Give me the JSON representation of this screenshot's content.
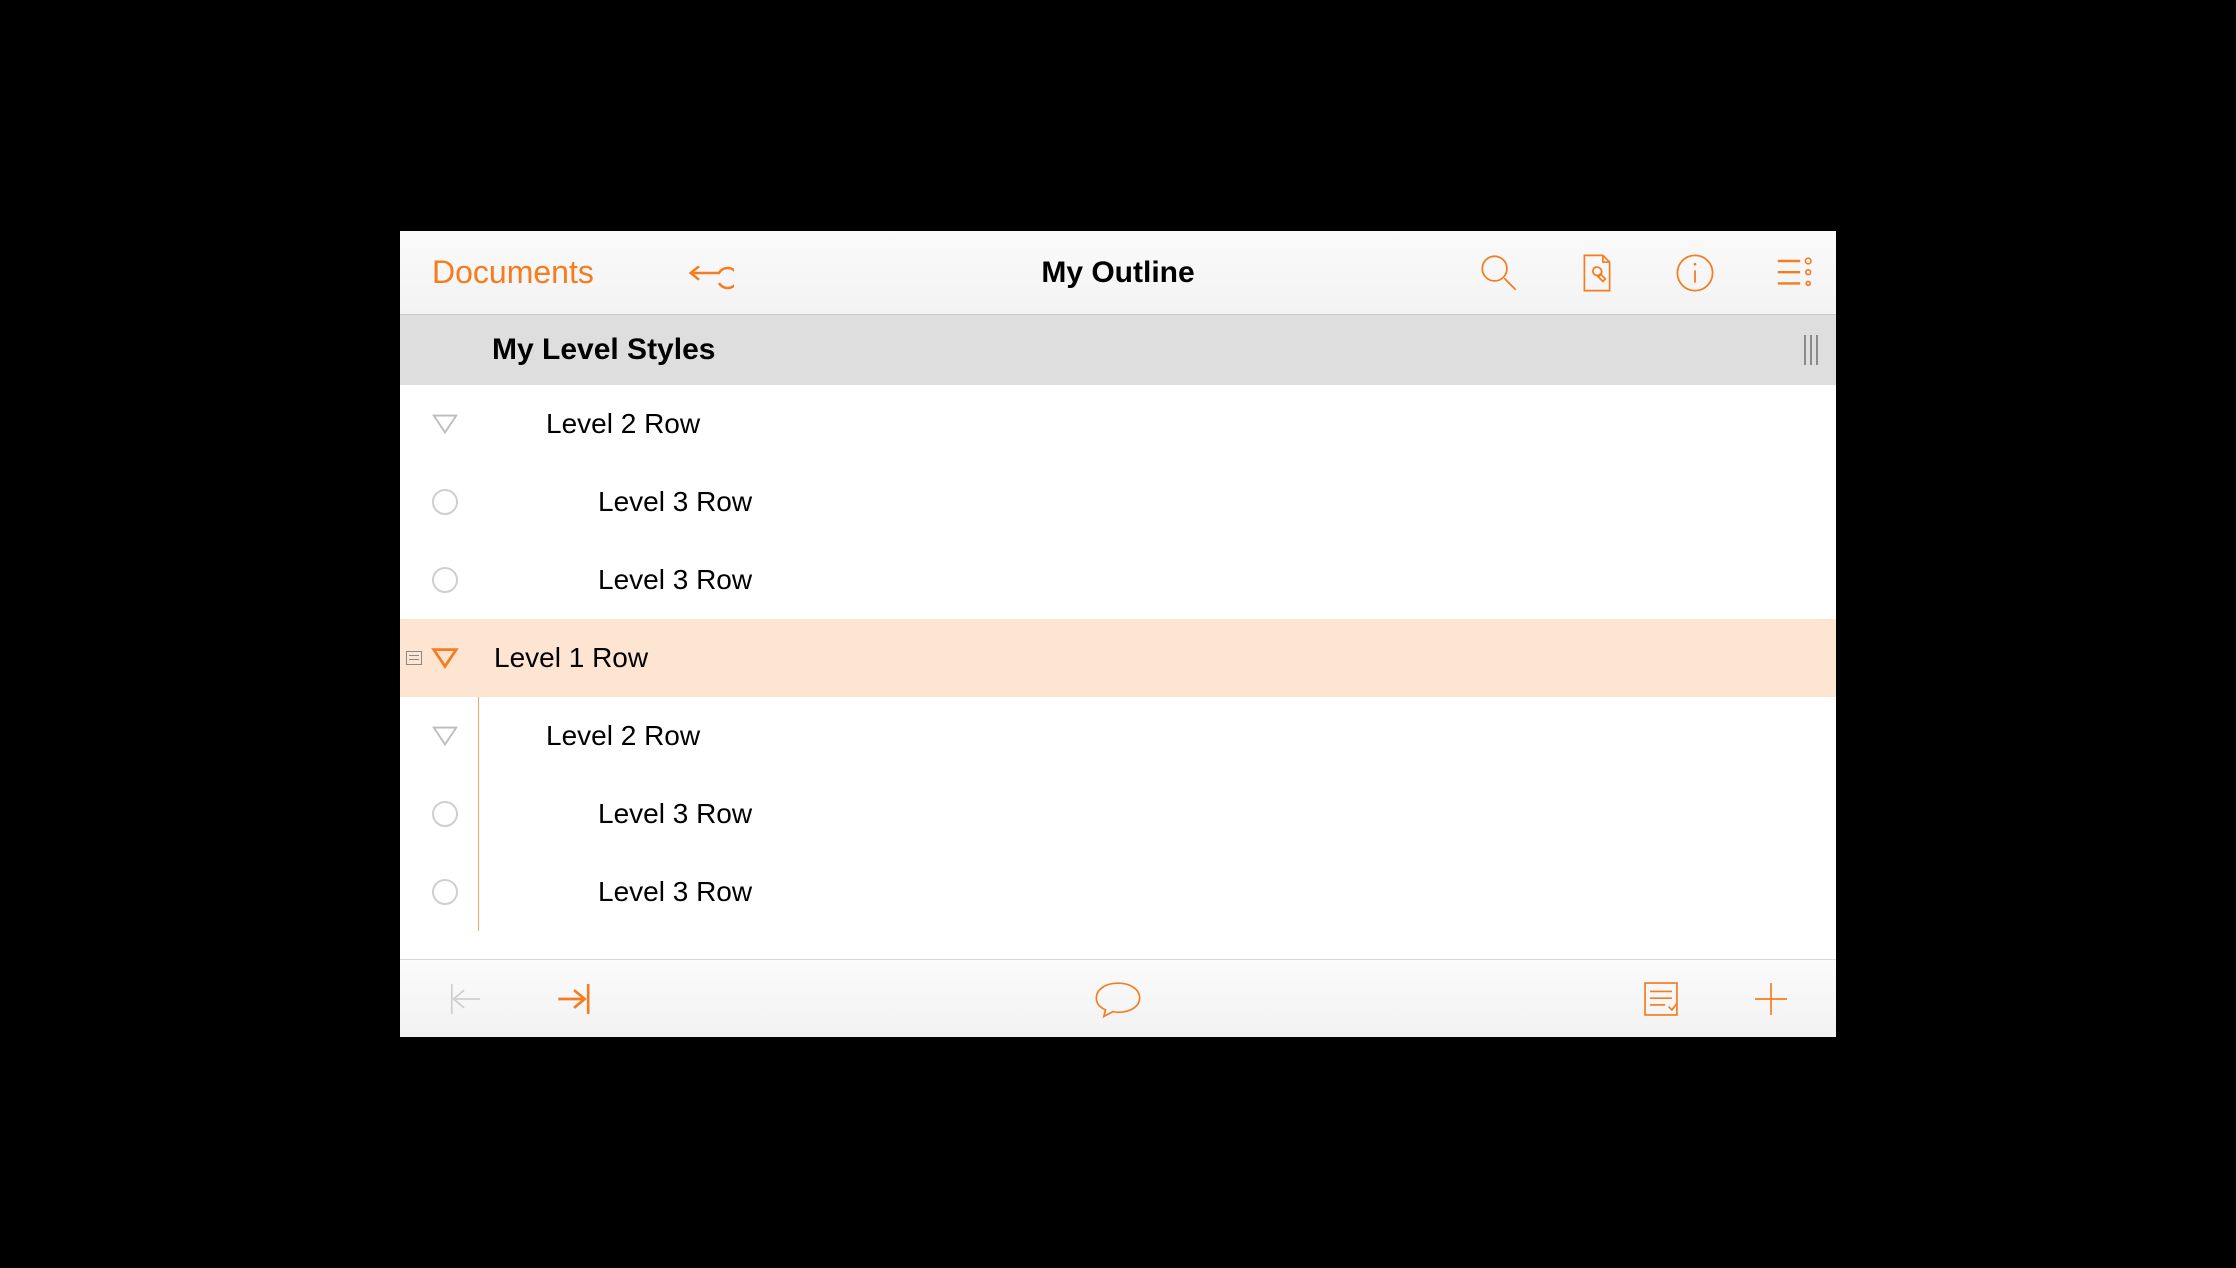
{
  "colors": {
    "accent": "#f57c1f",
    "selection": "#fde5d2"
  },
  "toolbar": {
    "back_label": "Documents",
    "title": "My Outline",
    "undo_icon": "undo-icon",
    "search_icon": "search-icon",
    "tools_icon": "wrench-document-icon",
    "info_icon": "info-icon",
    "more_icon": "bullet-list-icon"
  },
  "section": {
    "title": "My Level Styles"
  },
  "rows": [
    {
      "level": 2,
      "handle": "triangle",
      "label": "Level 2 Row",
      "selected": false,
      "hasNote": false
    },
    {
      "level": 3,
      "handle": "circle",
      "label": "Level 3 Row",
      "selected": false,
      "hasNote": false
    },
    {
      "level": 3,
      "handle": "circle",
      "label": "Level 3 Row",
      "selected": false,
      "hasNote": false
    },
    {
      "level": 1,
      "handle": "triangle",
      "label": "Level 1 Row",
      "selected": true,
      "hasNote": true
    },
    {
      "level": 2,
      "handle": "triangle",
      "label": "Level 2 Row",
      "selected": false,
      "hasNote": false
    },
    {
      "level": 3,
      "handle": "circle",
      "label": "Level 3 Row",
      "selected": false,
      "hasNote": false
    },
    {
      "level": 3,
      "handle": "circle",
      "label": "Level 3 Row",
      "selected": false,
      "hasNote": false
    }
  ],
  "bottom": {
    "outdent_enabled": false,
    "indent_enabled": true,
    "note_icon": "speech-bubble-icon",
    "notes_list_icon": "notes-list-icon",
    "add_icon": "plus-icon"
  }
}
